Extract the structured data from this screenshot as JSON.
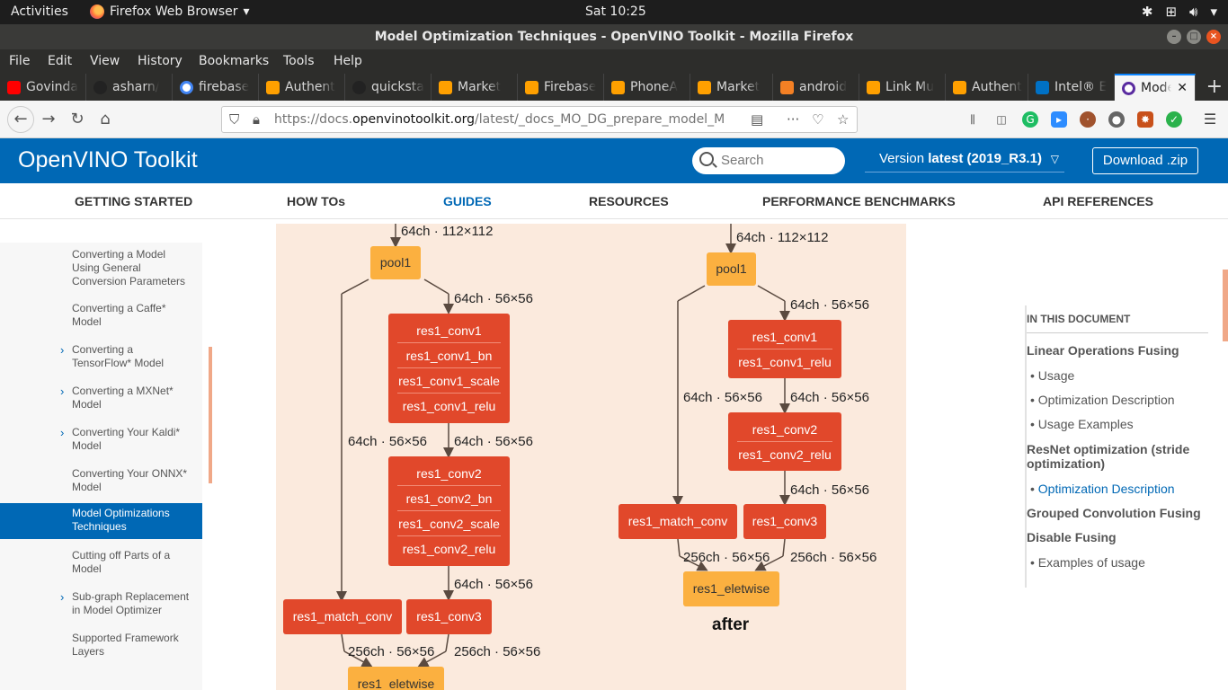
{
  "system": {
    "activities": "Activities",
    "app_menu": "Firefox Web Browser",
    "clock": "Sat 10:25"
  },
  "window": {
    "title": "Model Optimization Techniques - OpenVINO Toolkit - Mozilla Firefox"
  },
  "menu": [
    "File",
    "Edit",
    "View",
    "History",
    "Bookmarks",
    "Tools",
    "Help"
  ],
  "tabs": [
    {
      "label": "Govinda",
      "color": "#ff0000"
    },
    {
      "label": "asharn/",
      "color": "#222222"
    },
    {
      "label": "firebase",
      "color": "#4285f4"
    },
    {
      "label": "Authent",
      "color": "#ffa000"
    },
    {
      "label": "quicksta",
      "color": "#222222"
    },
    {
      "label": "Market",
      "color": "#ffa000"
    },
    {
      "label": "Firebase",
      "color": "#ffa000"
    },
    {
      "label": "PhoneA",
      "color": "#ffa000"
    },
    {
      "label": "Market",
      "color": "#ffa000"
    },
    {
      "label": "android",
      "color": "#f48024"
    },
    {
      "label": "Link Mu",
      "color": "#ffa000"
    },
    {
      "label": "Authent",
      "color": "#ffa000"
    },
    {
      "label": "Intel® E",
      "color": "#0071c5"
    },
    {
      "label": "Mode",
      "color": "#5a2ca0"
    }
  ],
  "url": {
    "prefix": "https://docs.",
    "domain": "openvinotoolkit.org",
    "path": "/latest/_docs_MO_DG_prepare_model_M"
  },
  "site": {
    "brand": "OpenVINO Toolkit",
    "search_placeholder": "Search",
    "version_prefix": "Version ",
    "version_value": "latest (2019_R3.1)",
    "download": "Download .zip"
  },
  "nav": [
    "GETTING STARTED",
    "HOW TOs",
    "GUIDES",
    "RESOURCES",
    "PERFORMANCE BENCHMARKS",
    "API REFERENCES"
  ],
  "sidebar": [
    {
      "label": "Converting a Model Using General Conversion Parameters",
      "arrow": false
    },
    {
      "label": "Converting a Caffe* Model",
      "arrow": false
    },
    {
      "label": "Converting a TensorFlow* Model",
      "arrow": true
    },
    {
      "label": "Converting a MXNet* Model",
      "arrow": true
    },
    {
      "label": "Converting Your Kaldi* Model",
      "arrow": true
    },
    {
      "label": "Converting Your ONNX* Model",
      "arrow": false
    },
    {
      "label": "Model Optimizations Techniques",
      "arrow": false
    },
    {
      "label": "Cutting off Parts of a Model",
      "arrow": false
    },
    {
      "label": "Sub-graph Replacement in Model Optimizer",
      "arrow": true
    },
    {
      "label": "Supported Framework Layers",
      "arrow": false
    }
  ],
  "diagram": {
    "left": {
      "in_label": "64ch · 112×112",
      "pool": "pool1",
      "edge1": "64ch · 56×56",
      "block1": [
        "res1_conv1",
        "res1_conv1_bn",
        "res1_conv1_scale",
        "res1_conv1_relu"
      ],
      "skip": "64ch · 56×56",
      "edge2": "64ch · 56×56",
      "block2": [
        "res1_conv2",
        "res1_conv2_bn",
        "res1_conv2_scale",
        "res1_conv2_relu"
      ],
      "edge3": "64ch · 56×56",
      "match": "res1_match_conv",
      "conv3": "res1_conv3",
      "out_a": "256ch · 56×56",
      "out_b": "256ch · 56×56",
      "elt": "res1_eletwise"
    },
    "right": {
      "in_label": "64ch · 112×112",
      "pool": "pool1",
      "edge1": "64ch · 56×56",
      "block1": [
        "res1_conv1",
        "res1_conv1_relu"
      ],
      "skip": "64ch · 56×56",
      "edge2": "64ch · 56×56",
      "block2": [
        "res1_conv2",
        "res1_conv2_relu"
      ],
      "edge3": "64ch · 56×56",
      "match": "res1_match_conv",
      "conv3": "res1_conv3",
      "out_a": "256ch · 56×56",
      "out_b": "256ch · 56×56",
      "elt": "res1_eletwise",
      "caption": "after"
    }
  },
  "toc": {
    "title": "IN THIS DOCUMENT",
    "s1": "Linear Operations Fusing",
    "s1_items": [
      "Usage",
      "Optimization Description",
      "Usage Examples"
    ],
    "s2": "ResNet optimization (stride optimization)",
    "s2_items": [
      "Optimization Description"
    ],
    "s3": "Grouped Convolution Fusing",
    "s4": "Disable Fusing",
    "s4_items": [
      "Examples of usage"
    ]
  },
  "colors": {
    "brand_blue": "#0068b5",
    "node_red": "#e1482b",
    "node_orange": "#fbb040",
    "diagram_bg": "#fbeadd"
  }
}
